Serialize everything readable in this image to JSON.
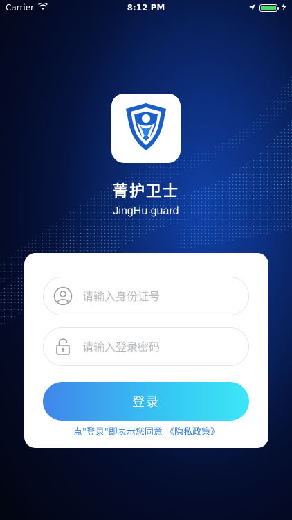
{
  "status_bar": {
    "carrier": "Carrier",
    "time": "8:12 PM",
    "battery_level": 1.0,
    "battery_color": "#4cd964"
  },
  "app": {
    "title": "菁护卫士",
    "subtitle": "JingHu guard",
    "logo_icon": "shield-person-icon",
    "brand_color": "#1b5fc8"
  },
  "login": {
    "id_placeholder": "请输入身份证号",
    "id_value": "",
    "id_icon": "user-icon",
    "password_placeholder": "请输入登录密码",
    "password_value": "",
    "password_icon": "lock-icon",
    "submit_label": "登录",
    "agreement_text": "点\"登录\"即表示您同意",
    "policy_link": "《隐私政策》",
    "accent_color": "#3a86d6"
  }
}
